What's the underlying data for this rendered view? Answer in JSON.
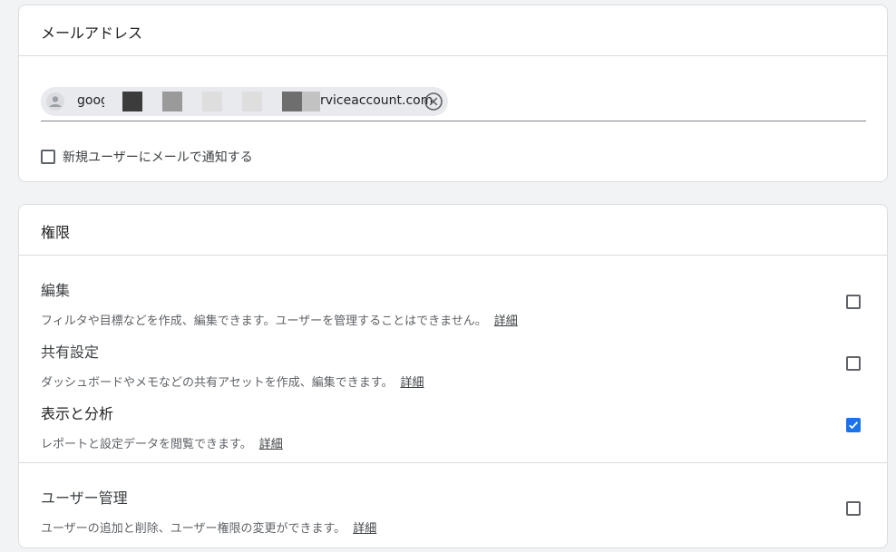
{
  "email_section": {
    "title": "メールアドレス",
    "chip": {
      "text_start": "goog",
      "text_end": "rviceaccount.com"
    },
    "notify": {
      "label": "新規ユーザーにメールで通知する",
      "checked": false
    }
  },
  "permissions_section": {
    "title": "権限",
    "items": [
      {
        "title": "編集",
        "desc": "フィルタや目標などを作成、編集できます。ユーザーを管理することはできません。",
        "link": "詳細",
        "checked": false
      },
      {
        "title": "共有設定",
        "desc": "ダッシュボードやメモなどの共有アセットを作成、編集できます。",
        "link": "詳細",
        "checked": false
      },
      {
        "title": "表示と分析",
        "desc": "レポートと設定データを閲覧できます。",
        "link": "詳細",
        "checked": true
      },
      {
        "title": "ユーザー管理",
        "desc": "ユーザーの追加と削除、ユーザー権限の変更ができます。",
        "link": "詳細",
        "checked": false
      }
    ]
  },
  "colors": {
    "accent": "#1a73e8",
    "chip_bg": "#e8eaed"
  }
}
